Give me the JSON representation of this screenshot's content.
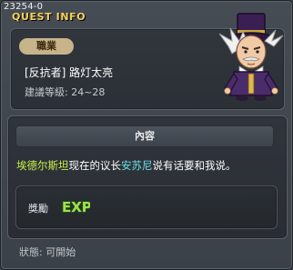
{
  "window": {
    "quest_id": "23254-0",
    "title": "QUEST INFO"
  },
  "info": {
    "job_tag": "職業",
    "job_name": "[反抗者] 路灯太亮",
    "required_level": "建議等級: 24~28",
    "npc_icon": "npc-portrait-top-hat-mayor"
  },
  "detail": {
    "content_header": "內容",
    "description": {
      "npc_name": "埃德尔斯坦",
      "part1": "现在的议长",
      "leader_name": "安苏尼",
      "part2": "说有话要和我说。"
    }
  },
  "reward": {
    "label": "獎勵",
    "exp_icon": "exp-icon",
    "exp_text": "EXP"
  },
  "status": {
    "text": "狀態: 可開始"
  },
  "colors": {
    "title": "#f6d25a",
    "highlight_green": "#c9f04a",
    "highlight_cyan": "#6ee0ea",
    "exp_green": "#9be34a"
  }
}
